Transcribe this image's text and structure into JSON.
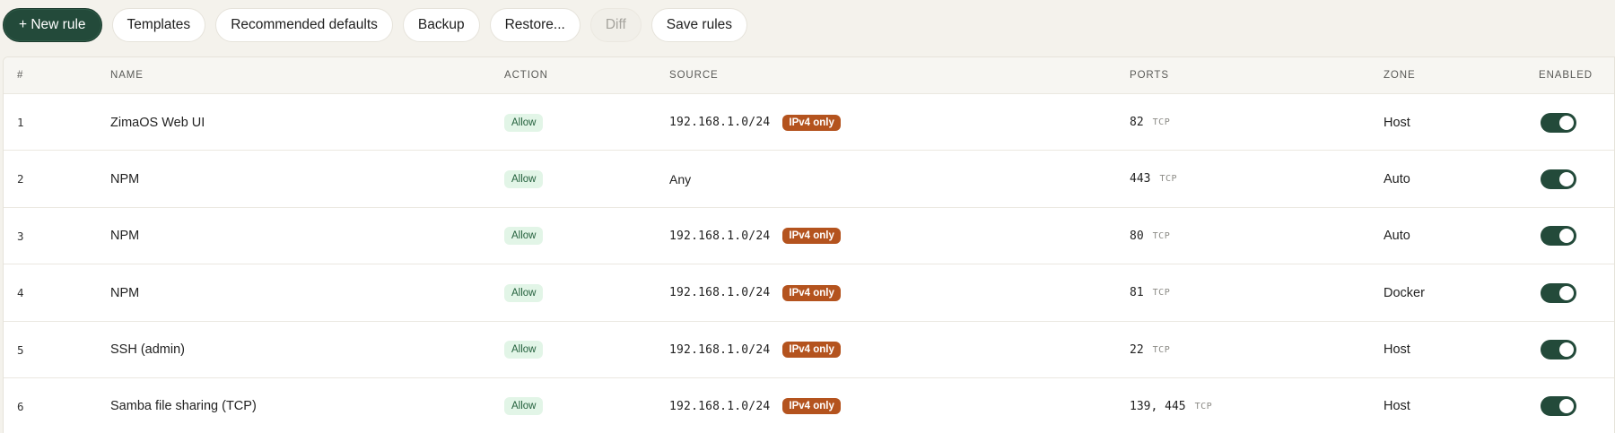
{
  "toolbar": {
    "new_rule": "+ New rule",
    "templates": "Templates",
    "recommended": "Recommended defaults",
    "backup": "Backup",
    "restore": "Restore...",
    "diff": "Diff",
    "save": "Save rules"
  },
  "table": {
    "headers": {
      "num": "#",
      "name": "NAME",
      "action": "ACTION",
      "source": "SOURCE",
      "ports": "PORTS",
      "zone": "ZONE",
      "enabled": "ENABLED"
    },
    "rows": [
      {
        "num": "1",
        "name": "ZimaOS Web UI",
        "action": "Allow",
        "source": "192.168.1.0/24",
        "source_badge": "IPv4 only",
        "ports": "82",
        "proto": "TCP",
        "zone": "Host",
        "enabled": true
      },
      {
        "num": "2",
        "name": "NPM",
        "action": "Allow",
        "source": "Any",
        "source_badge": "",
        "ports": "443",
        "proto": "TCP",
        "zone": "Auto",
        "enabled": true
      },
      {
        "num": "3",
        "name": "NPM",
        "action": "Allow",
        "source": "192.168.1.0/24",
        "source_badge": "IPv4 only",
        "ports": "80",
        "proto": "TCP",
        "zone": "Auto",
        "enabled": true
      },
      {
        "num": "4",
        "name": "NPM",
        "action": "Allow",
        "source": "192.168.1.0/24",
        "source_badge": "IPv4 only",
        "ports": "81",
        "proto": "TCP",
        "zone": "Docker",
        "enabled": true
      },
      {
        "num": "5",
        "name": "SSH (admin)",
        "action": "Allow",
        "source": "192.168.1.0/24",
        "source_badge": "IPv4 only",
        "ports": "22",
        "proto": "TCP",
        "zone": "Host",
        "enabled": true
      },
      {
        "num": "6",
        "name": "Samba file sharing (TCP)",
        "action": "Allow",
        "source": "192.168.1.0/24",
        "source_badge": "IPv4 only",
        "ports": "139, 445",
        "proto": "TCP",
        "zone": "Host",
        "enabled": true
      }
    ]
  },
  "colors": {
    "primary": "#234a3a",
    "allow_bg": "#e2f5e7",
    "allow_text": "#24613d",
    "ipv4_badge": "#b4531e",
    "background": "#f4f2ec"
  }
}
